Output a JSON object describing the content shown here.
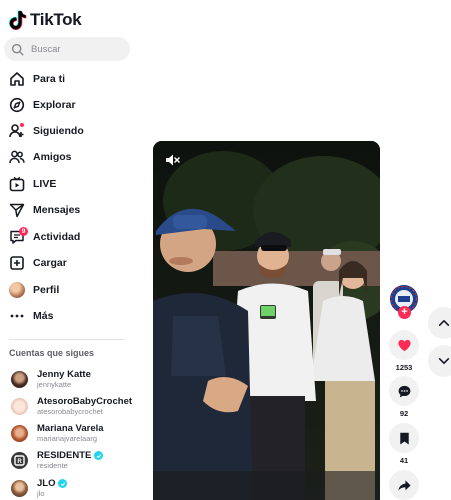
{
  "brand": {
    "name": "TikTok"
  },
  "search": {
    "placeholder": "Buscar"
  },
  "nav": [
    {
      "label": "Para ti",
      "icon": "home-icon"
    },
    {
      "label": "Explorar",
      "icon": "compass-icon"
    },
    {
      "label": "Siguiendo",
      "icon": "following-icon"
    },
    {
      "label": "Amigos",
      "icon": "friends-icon"
    },
    {
      "label": "LIVE",
      "icon": "live-icon"
    },
    {
      "label": "Mensajes",
      "icon": "paper-plane-icon"
    },
    {
      "label": "Actividad",
      "icon": "comment-bubble-icon",
      "badge": "9"
    },
    {
      "label": "Cargar",
      "icon": "plus-square-icon"
    },
    {
      "label": "Perfil",
      "icon": "avatar-icon"
    },
    {
      "label": "Más",
      "icon": "more-icon"
    }
  ],
  "following": {
    "title": "Cuentas que sigues",
    "accounts": [
      {
        "name": "Jenny Katte",
        "username": "jennykatte",
        "verified": false
      },
      {
        "name": "AtesoroBabyCrochet",
        "username": "atesorobabycrochet",
        "verified": false
      },
      {
        "name": "Mariana Varela",
        "username": "marianajvarelaarg",
        "verified": false
      },
      {
        "name": "RESIDENTE",
        "username": "residente",
        "verified": true
      },
      {
        "name": "JLO",
        "username": "jlo",
        "verified": true
      }
    ]
  },
  "actions": {
    "likes": "1253",
    "comments": "92",
    "saves": "41"
  },
  "colors": {
    "accent": "#fe2c55",
    "verified": "#20d5ec",
    "surface": "#f1f1f2",
    "text": "#161823",
    "muted": "#8a8b91"
  }
}
